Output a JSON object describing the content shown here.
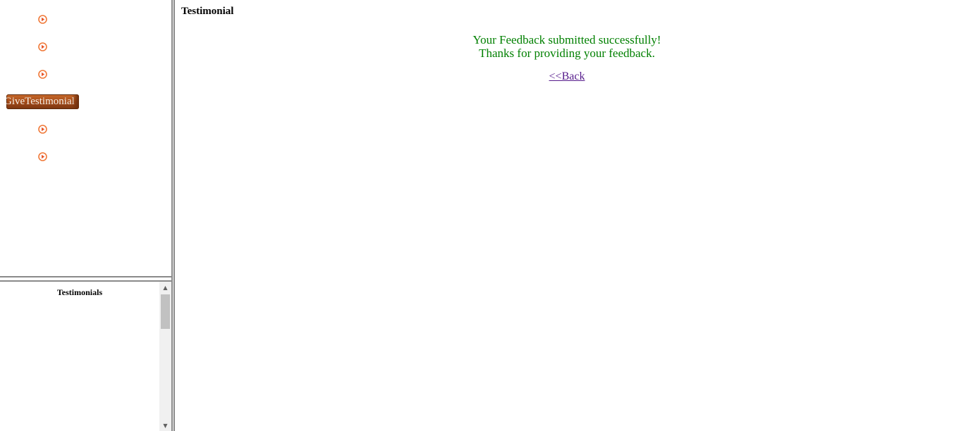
{
  "nav": {
    "active_item_label": "GiveTestimonial",
    "items": [
      {
        "icon": "play-bullet-icon"
      },
      {
        "icon": "play-bullet-icon"
      },
      {
        "icon": "play-bullet-icon"
      },
      {
        "icon": "play-bullet-icon"
      },
      {
        "icon": "play-bullet-icon"
      }
    ]
  },
  "testimonials_panel": {
    "title": "Testimonials"
  },
  "main": {
    "title": "Testimonial",
    "message_line1": "Your Feedback submitted successfully!",
    "message_line2": "Thanks for providing your feedback.",
    "back_label": "<<Back"
  },
  "colors": {
    "success_text": "#008000",
    "visited_link": "#551a8b",
    "active_nav_bg": "#a94e1a",
    "bullet_orange": "#f07a3a"
  }
}
